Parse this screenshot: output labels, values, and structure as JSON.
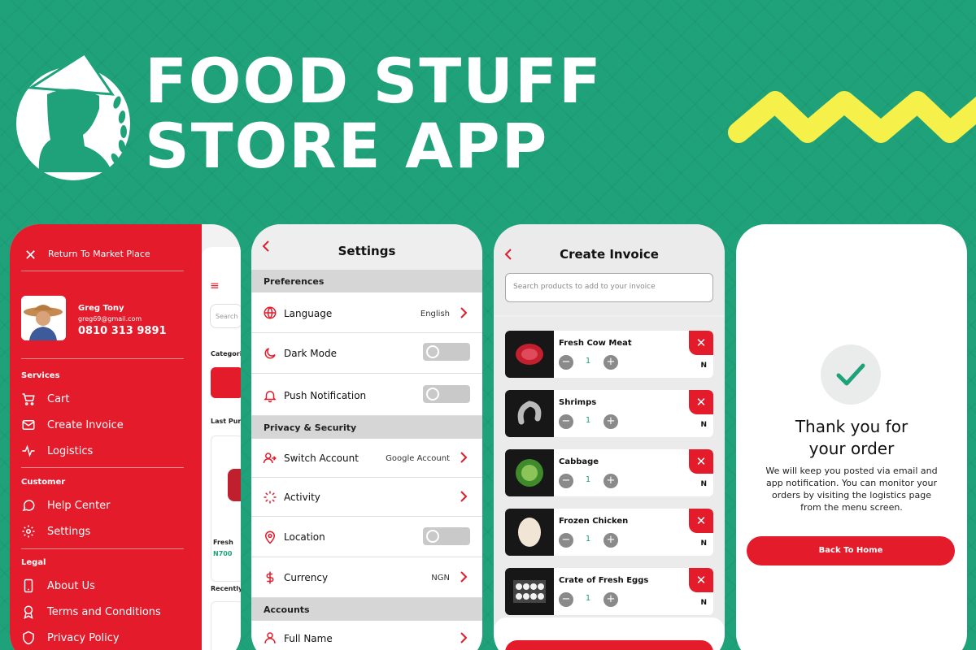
{
  "hero": {
    "title_line1": "FOOD STUFF",
    "title_line2": "STORE APP",
    "brand_color": "#1fa27a",
    "accent_color": "#e31b2a",
    "zigzag_color": "#f5f04a"
  },
  "drawer": {
    "return_label": "Return To Market Place",
    "user": {
      "name": "Greg Tony",
      "email": "greg69@gmail.com",
      "phone": "0810 313 9891"
    },
    "sections": [
      {
        "title": "Services",
        "items": [
          {
            "label": "Cart",
            "icon": "cart-icon"
          },
          {
            "label": "Create Invoice",
            "icon": "mail-icon"
          },
          {
            "label": "Logistics",
            "icon": "pulse-icon"
          }
        ]
      },
      {
        "title": "Customer",
        "items": [
          {
            "label": "Help Center",
            "icon": "chat-icon"
          },
          {
            "label": "Settings",
            "icon": "gear-icon"
          }
        ]
      },
      {
        "title": "Legal",
        "items": [
          {
            "label": "About Us",
            "icon": "phone-icon"
          },
          {
            "label": "Terms and Conditions",
            "icon": "award-icon"
          },
          {
            "label": "Privacy Policy",
            "icon": "shield-icon"
          }
        ]
      }
    ],
    "peek": {
      "search": "Search",
      "categories": "Categori",
      "last_purchase": "Last Purc",
      "item_name": "Fresh",
      "item_price": "N700",
      "recently": "Recently"
    }
  },
  "settings": {
    "title": "Settings",
    "sections": [
      {
        "title": "Preferences",
        "rows": [
          {
            "label": "Language",
            "value": "English",
            "control": "chevron"
          },
          {
            "label": "Dark Mode",
            "value": "",
            "control": "toggle"
          },
          {
            "label": "Push Notification",
            "value": "",
            "control": "toggle"
          }
        ]
      },
      {
        "title": "Privacy & Security",
        "rows": [
          {
            "label": "Switch Account",
            "value": "Google Account",
            "control": "chevron"
          },
          {
            "label": "Activity",
            "value": "",
            "control": "chevron"
          },
          {
            "label": "Location",
            "value": "",
            "control": "toggle"
          },
          {
            "label": "Currency",
            "value": "NGN",
            "control": "chevron"
          }
        ]
      },
      {
        "title": "Accounts",
        "rows": [
          {
            "label": "Full Name",
            "value": "",
            "control": "chevron"
          }
        ]
      }
    ]
  },
  "invoice": {
    "title": "Create Invoice",
    "search_placeholder": "Search products to add to your invoice",
    "currency": "N",
    "items": [
      {
        "name": "Fresh Cow Meat",
        "qty": "1"
      },
      {
        "name": "Shrimps",
        "qty": "1"
      },
      {
        "name": "Cabbage",
        "qty": "1"
      },
      {
        "name": "Frozen Chicken",
        "qty": "1"
      },
      {
        "name": "Crate of Fresh Eggs",
        "qty": "1"
      }
    ]
  },
  "confirmation": {
    "title_line1": "Thank you for",
    "title_line2": "your order",
    "message": "We will keep you posted via email and app notification. You can monitor your orders by visiting the logistics page from the menu screen.",
    "button": "Back To Home"
  }
}
